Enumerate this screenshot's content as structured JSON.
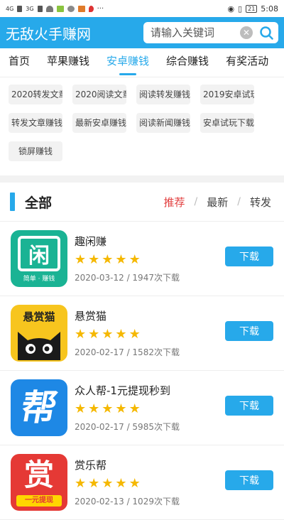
{
  "status_bar": {
    "left_signal_labels": [
      "4G",
      "3G"
    ],
    "battery": "21",
    "time": "5:08"
  },
  "header": {
    "title": "无敌火手赚网",
    "search_placeholder": "请输入关键词"
  },
  "tabs": [
    {
      "label": "首页",
      "active": false
    },
    {
      "label": "苹果赚钱",
      "active": false
    },
    {
      "label": "安卓赚钱",
      "active": true
    },
    {
      "label": "综合赚钱",
      "active": false
    },
    {
      "label": "有奖活动",
      "active": false
    }
  ],
  "chips": [
    "2020转发文章",
    "2020阅读文章",
    "阅读转发赚钱",
    "2019安卓试玩",
    "转发文章赚钱",
    "最新安卓赚钱",
    "阅读新闻赚钱",
    "安卓试玩下载",
    "锁屏赚钱"
  ],
  "section": {
    "title": "全部",
    "sort": [
      "推荐",
      "最新",
      "转发"
    ],
    "sort_active": "推荐"
  },
  "download_label": "下载",
  "apps": [
    {
      "name": "趣闲赚",
      "date": "2020-03-12",
      "downloads": "1947次下载",
      "rating": 5,
      "icon_text": "闲",
      "icon_sub": "简单 · 赚钱",
      "icon": "quxianzhuan-icon"
    },
    {
      "name": "悬赏猫",
      "date": "2020-02-17",
      "downloads": "1582次下载",
      "rating": 5,
      "icon_text": "悬赏猫",
      "icon": "xuanshangmao-icon"
    },
    {
      "name": "众人帮-1元提现秒到",
      "date": "2020-02-17",
      "downloads": "5985次下载",
      "rating": 5,
      "icon_text": "帮",
      "icon": "zhongrenbang-icon"
    },
    {
      "name": "赏乐帮",
      "date": "2020-02-13",
      "downloads": "1029次下载",
      "rating": 5,
      "icon_text": "赏",
      "icon_sub": "一元提现",
      "icon": "shanglebang-icon"
    }
  ],
  "colors": {
    "accent": "#27a9ea",
    "star": "#f5b800",
    "sort_active": "#e23d3d"
  }
}
